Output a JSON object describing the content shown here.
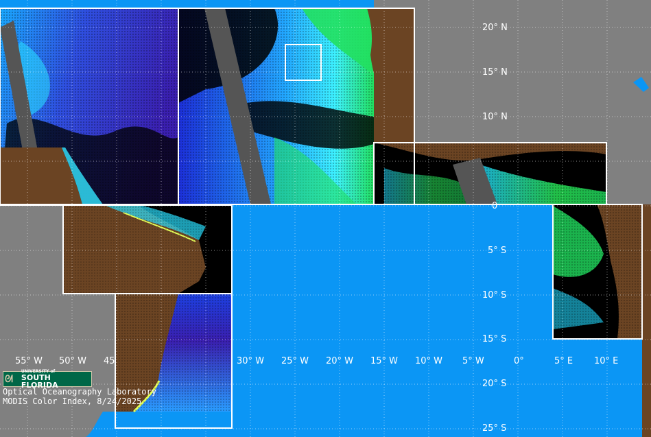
{
  "map": {
    "lon_labels": [
      "55° W",
      "50° W",
      "45",
      "30° W",
      "25° W",
      "20° W",
      "15° W",
      "10° W",
      "5° W",
      "0°",
      "5° E",
      "10° E"
    ],
    "lat_labels": [
      "20° N",
      "15° N",
      "10° N",
      "0",
      "5° S",
      "10° S",
      "15° S",
      "20° S",
      "25° S"
    ]
  },
  "credit": {
    "logo_top": "UNIVERSITY of",
    "logo_bottom": "SOUTH FLORIDA",
    "lab": "Optical Oceanography Laboratory",
    "product": "MODIS Color Index, 8/24/2025"
  },
  "colors": {
    "land": "#6b4423",
    "ocean_fill": "#0b96f5",
    "background": "#808080",
    "no_data": "#000000",
    "usf_green": "#006747"
  }
}
